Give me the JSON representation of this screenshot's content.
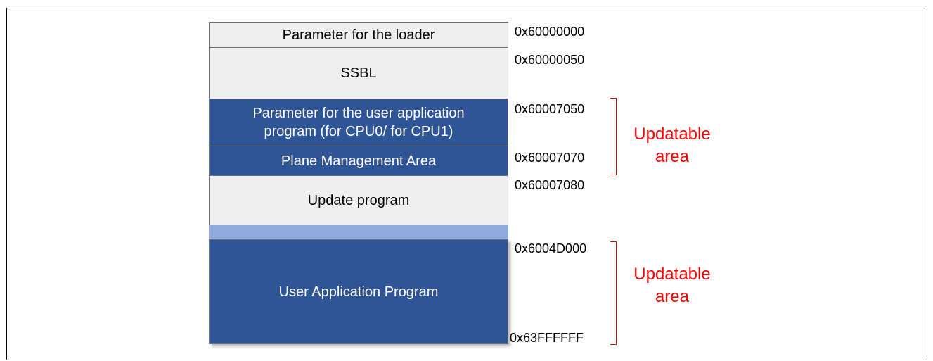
{
  "memory_map": {
    "blocks": [
      {
        "label": "Parameter for the loader"
      },
      {
        "label": "SSBL"
      },
      {
        "label_line1": "Parameter for the user application",
        "label_line2": "program (for CPU0/ for CPU1)"
      },
      {
        "label": "Plane Management Area"
      },
      {
        "label": "Update program"
      },
      {
        "label": "User Application Program"
      }
    ],
    "addresses": [
      "0x60000000",
      "0x60000050",
      "0x60007050",
      "0x60007070",
      "0x60007080",
      "0x6004D000",
      "0x63FFFFFF"
    ],
    "updatable_areas": [
      {
        "line1": "Updatable",
        "line2": "area"
      },
      {
        "line1": "Updatable",
        "line2": "area"
      }
    ],
    "colors": {
      "light_block": "#efefef",
      "dark_block": "#2f5597",
      "gap_block": "#8faadc",
      "updatable_text": "#ff0000"
    }
  }
}
